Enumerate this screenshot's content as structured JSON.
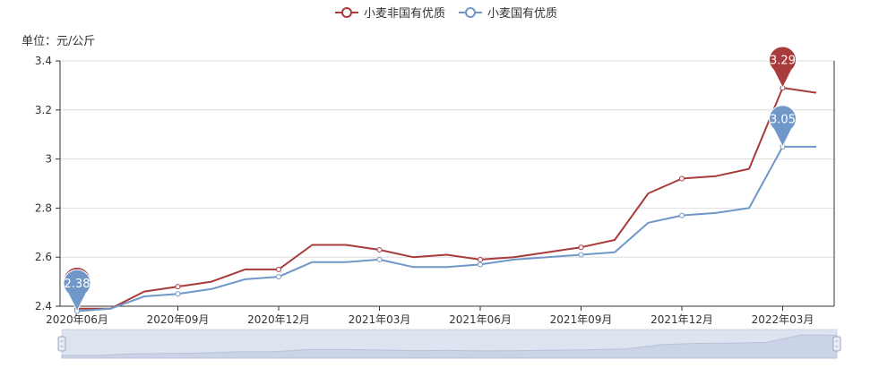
{
  "chart_data": {
    "type": "line",
    "unit_label": "单位：元/公斤",
    "x": [
      "2020年06月",
      "2020年07月",
      "2020年08月",
      "2020年09月",
      "2020年10月",
      "2020年11月",
      "2020年12月",
      "2021年01月",
      "2021年02月",
      "2021年03月",
      "2021年04月",
      "2021年05月",
      "2021年06月",
      "2021年07月",
      "2021年08月",
      "2021年09月",
      "2021年10月",
      "2021年11月",
      "2021年12月",
      "2022年01月",
      "2022年02月",
      "2022年03月",
      "2022年04月"
    ],
    "x_tick_labels": [
      "2020年06月",
      "2020年09月",
      "2020年12月",
      "2021年03月",
      "2021年06月",
      "2021年09月",
      "2021年12月",
      "2022年03月"
    ],
    "y_ticks": [
      2.4,
      2.6,
      2.8,
      3,
      3.2,
      3.4
    ],
    "y_tick_labels": [
      "2.4",
      "2.6",
      "2.8",
      "3",
      "3.2",
      "3.4"
    ],
    "ylim": [
      2.4,
      3.4
    ],
    "grid": true,
    "legend_position": "top-center",
    "series": [
      {
        "name": "小麦非国有优质",
        "color": "#a83b3b",
        "values": [
          2.39,
          2.39,
          2.46,
          2.48,
          2.5,
          2.55,
          2.55,
          2.65,
          2.65,
          2.63,
          2.6,
          2.61,
          2.59,
          2.6,
          2.62,
          2.64,
          2.67,
          2.86,
          2.92,
          2.93,
          2.96,
          3.29,
          3.27
        ],
        "markers": [
          {
            "x": "2022年03月",
            "value": 3.29,
            "label": "3.29"
          },
          {
            "x": "2020年06月",
            "value": 2.39,
            "label": ""
          }
        ]
      },
      {
        "name": "小麦国有优质",
        "color": "#7097c8",
        "values": [
          2.38,
          2.39,
          2.44,
          2.45,
          2.47,
          2.51,
          2.52,
          2.58,
          2.58,
          2.59,
          2.56,
          2.56,
          2.57,
          2.59,
          2.6,
          2.61,
          2.62,
          2.74,
          2.77,
          2.78,
          2.8,
          3.05,
          3.05
        ],
        "markers": [
          {
            "x": "2022年03月",
            "value": 3.05,
            "label": "3.05"
          },
          {
            "x": "2020年06月",
            "value": 2.38,
            "label": "2.38"
          }
        ]
      }
    ]
  },
  "slider": {
    "start_fraction": 0,
    "end_fraction": 1
  }
}
